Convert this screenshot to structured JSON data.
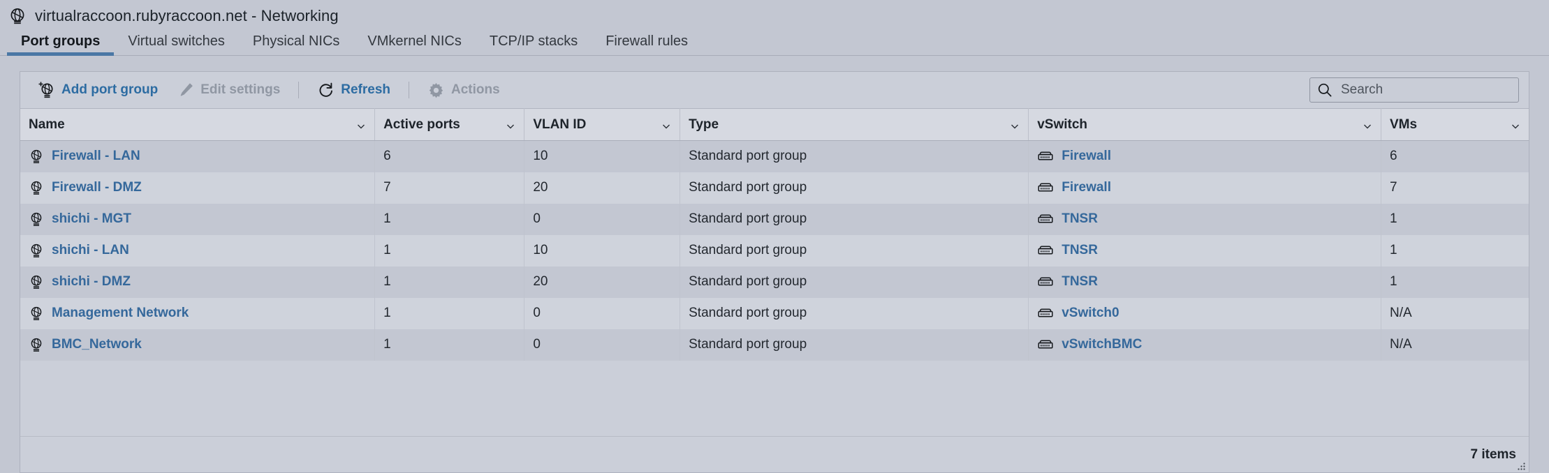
{
  "header": {
    "icon": "network-globe-icon",
    "title": "virtualraccoon.rubyraccoon.net - Networking"
  },
  "tabs": [
    {
      "label": "Port groups",
      "active": true
    },
    {
      "label": "Virtual switches",
      "active": false
    },
    {
      "label": "Physical NICs",
      "active": false
    },
    {
      "label": "VMkernel NICs",
      "active": false
    },
    {
      "label": "TCP/IP stacks",
      "active": false
    },
    {
      "label": "Firewall rules",
      "active": false
    }
  ],
  "toolbar": {
    "add_label": "Add port group",
    "add_icon": "add-port-group-icon",
    "edit_label": "Edit settings",
    "edit_icon": "pencil-icon",
    "refresh_label": "Refresh",
    "refresh_icon": "refresh-icon",
    "actions_label": "Actions",
    "actions_icon": "gear-icon"
  },
  "search": {
    "icon": "search-icon",
    "placeholder": "Search",
    "value": ""
  },
  "table": {
    "columns": [
      {
        "label": "Name",
        "sort_icon": "chevron-down-icon"
      },
      {
        "label": "Active ports",
        "sort_icon": "chevron-down-icon"
      },
      {
        "label": "VLAN ID",
        "sort_icon": "chevron-down-icon"
      },
      {
        "label": "Type",
        "sort_icon": "chevron-down-icon"
      },
      {
        "label": "vSwitch",
        "sort_icon": "chevron-down-icon"
      },
      {
        "label": "VMs",
        "sort_icon": "chevron-down-icon"
      }
    ],
    "rows": [
      {
        "name": "Firewall - LAN",
        "active_ports": "6",
        "vlan_id": "10",
        "type": "Standard port group",
        "vswitch": "Firewall",
        "vms": "6"
      },
      {
        "name": "Firewall - DMZ",
        "active_ports": "7",
        "vlan_id": "20",
        "type": "Standard port group",
        "vswitch": "Firewall",
        "vms": "7"
      },
      {
        "name": "shichi - MGT",
        "active_ports": "1",
        "vlan_id": "0",
        "type": "Standard port group",
        "vswitch": "TNSR",
        "vms": "1"
      },
      {
        "name": "shichi - LAN",
        "active_ports": "1",
        "vlan_id": "10",
        "type": "Standard port group",
        "vswitch": "TNSR",
        "vms": "1"
      },
      {
        "name": "shichi - DMZ",
        "active_ports": "1",
        "vlan_id": "20",
        "type": "Standard port group",
        "vswitch": "TNSR",
        "vms": "1"
      },
      {
        "name": "Management Network",
        "active_ports": "1",
        "vlan_id": "0",
        "type": "Standard port group",
        "vswitch": "vSwitch0",
        "vms": "N/A"
      },
      {
        "name": "BMC_Network",
        "active_ports": "1",
        "vlan_id": "0",
        "type": "Standard port group",
        "vswitch": "vSwitchBMC",
        "vms": "N/A"
      }
    ],
    "row_icon": "port-group-icon",
    "vswitch_icon": "vswitch-icon"
  },
  "footer": {
    "item_count": "7 items",
    "resize_icon": "resize-grip-icon"
  },
  "colors": {
    "link": "#35689b",
    "accent": "#4a77a5",
    "page_bg": "#c3c7d2",
    "header_row": "#d6d9e1",
    "disabled": "#9097a3"
  }
}
